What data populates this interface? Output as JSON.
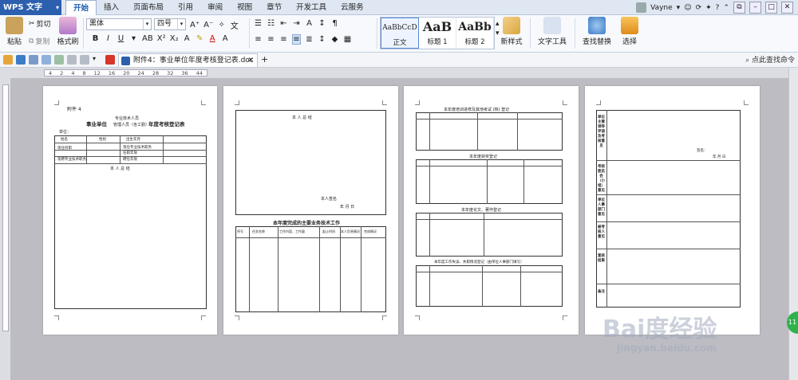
{
  "app": {
    "name": "WPS 文字"
  },
  "menu": {
    "tabs": [
      "开始",
      "插入",
      "页面布局",
      "引用",
      "审阅",
      "视图",
      "章节",
      "开发工具",
      "云服务"
    ],
    "active_index": 0
  },
  "user": {
    "name": "Vayne",
    "help": "?"
  },
  "clipboard": {
    "paste": "粘贴",
    "cut": "剪切",
    "copy": "复制",
    "format_painter": "格式刷"
  },
  "font": {
    "name": "黑体",
    "size": "四号"
  },
  "styles": {
    "items": [
      {
        "sample": "AaBbCcD",
        "label": "正文"
      },
      {
        "sample": "AaB",
        "label": "标题 1"
      },
      {
        "sample": "AaBb",
        "label": "标题 2"
      }
    ]
  },
  "ribbon_right": {
    "new_style": "新样式",
    "text_tool": "文字工具",
    "find_replace": "查找替换",
    "select": "选择"
  },
  "document_tab": {
    "title": "附件4：事业单位年度考核登记表.doc"
  },
  "find": {
    "placeholder": "点此查找命令"
  },
  "ruler": {
    "marks": [
      "4",
      "2",
      "4",
      "8",
      "12",
      "16",
      "20",
      "24",
      "28",
      "32",
      "36",
      "",
      "44"
    ]
  },
  "pages": {
    "p1": {
      "annex": "附件 4",
      "title_left": "事业单位",
      "title_mid1": "专业技术人员",
      "title_mid2": "管理人员（含工勤）",
      "title_right": "年度考核登记表",
      "unit": "单位：",
      "row_labels": [
        "姓名",
        "性别",
        "出生年月",
        "现任何职",
        "现任专业技术职务",
        "任职年限",
        "现聘专业技术职务",
        "聘任年限"
      ],
      "work_summary": "本 人 总 结"
    },
    "p2": {
      "summary": "本 人 总 结",
      "sign": "本人签名",
      "date": "年 月 日",
      "section_title": "本年度完成的主要业务技术工作",
      "headers": [
        "序号",
        "任务名称",
        "工作内容、工作量",
        "起止时间",
        "本人负责情况",
        "完成情况"
      ]
    },
    "p3": {
      "sec1": "本年度培训进修及其他考试 (核) 登记",
      "sec2": "本年度获奖登记",
      "sec3": "本年度论文、著作登记",
      "sec4": "本年度工作失误、失职情况登记（由单位人事部门填写）"
    },
    "p4": {
      "rows": [
        "单位主管领导评语及考核意见",
        "考核委员会（小组）意见",
        "单位人事部门意见",
        "被考核人意见",
        "复核结果",
        "备注"
      ],
      "sign": "签名：",
      "date": "年 月 日"
    }
  },
  "watermark": {
    "brand": "Bai度经验",
    "url": "jingyan.baidu.com"
  },
  "badge": {
    "text": "11"
  }
}
